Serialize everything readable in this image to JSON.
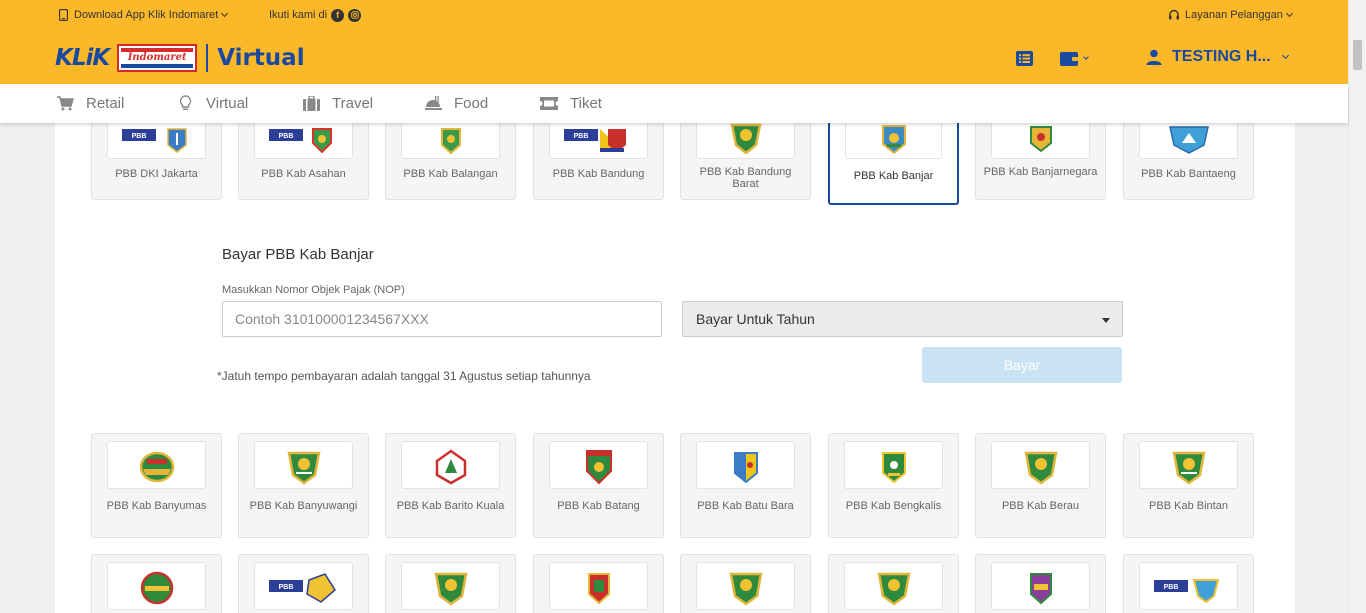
{
  "topbar": {
    "download_app": "Download App Klik Indomaret",
    "follow_us": "Ikuti kami di",
    "customer_service": "Layanan Pelanggan"
  },
  "brand": {
    "klik": "KLiK",
    "indomaret": "Indomaret",
    "section": "Virtual"
  },
  "user": {
    "name": "TESTING H..."
  },
  "nav": {
    "tabs": [
      {
        "label": "Retail",
        "icon": "cart-icon"
      },
      {
        "label": "Virtual",
        "icon": "lightbulb-icon"
      },
      {
        "label": "Travel",
        "icon": "luggage-icon"
      },
      {
        "label": "Food",
        "icon": "food-icon"
      },
      {
        "label": "Tiket",
        "icon": "ticket-icon"
      }
    ]
  },
  "cards_top": [
    {
      "name": "PBB DKI Jakarta",
      "logo_text": "PBB"
    },
    {
      "name": "PBB Kab Asahan",
      "logo_text": "PBB"
    },
    {
      "name": "PBB Kab Balangan",
      "logo_text": ""
    },
    {
      "name": "PBB Kab Bandung",
      "logo_text": "PBB"
    },
    {
      "name": "PBB Kab Bandung Barat",
      "logo_text": ""
    },
    {
      "name": "PBB Kab Banjar",
      "logo_text": "",
      "selected": true
    },
    {
      "name": "PBB Kab Banjarnegara",
      "logo_text": ""
    },
    {
      "name": "PBB Kab Bantaeng",
      "logo_text": ""
    }
  ],
  "form": {
    "title": "Bayar PBB Kab Banjar",
    "nop_label": "Masukkan Nomor Objek Pajak (NOP)",
    "nop_placeholder": "Contoh 310100001234567XXX",
    "year_select": "Bayar Untuk Tahun",
    "note": "*Jatuh tempo pembayaran adalah tanggal 31 Agustus setiap tahunnya",
    "pay_button": "Bayar"
  },
  "cards_middle": [
    {
      "name": "PBB Kab Banyumas"
    },
    {
      "name": "PBB Kab Banyuwangi"
    },
    {
      "name": "PBB Kab Barito Kuala"
    },
    {
      "name": "PBB Kab Batang"
    },
    {
      "name": "PBB Kab Batu Bara"
    },
    {
      "name": "PBB Kab Bengkalis"
    },
    {
      "name": "PBB Kab Berau"
    },
    {
      "name": "PBB Kab Bintan"
    }
  ],
  "cards_bottom_logo_texts": [
    "",
    "PBB",
    "",
    "",
    "",
    "",
    "",
    "PBB"
  ],
  "colors": {
    "brand_yellow": "#fbb829",
    "brand_blue": "#1a4aa0",
    "button_disabled": "#c9e2f4"
  }
}
